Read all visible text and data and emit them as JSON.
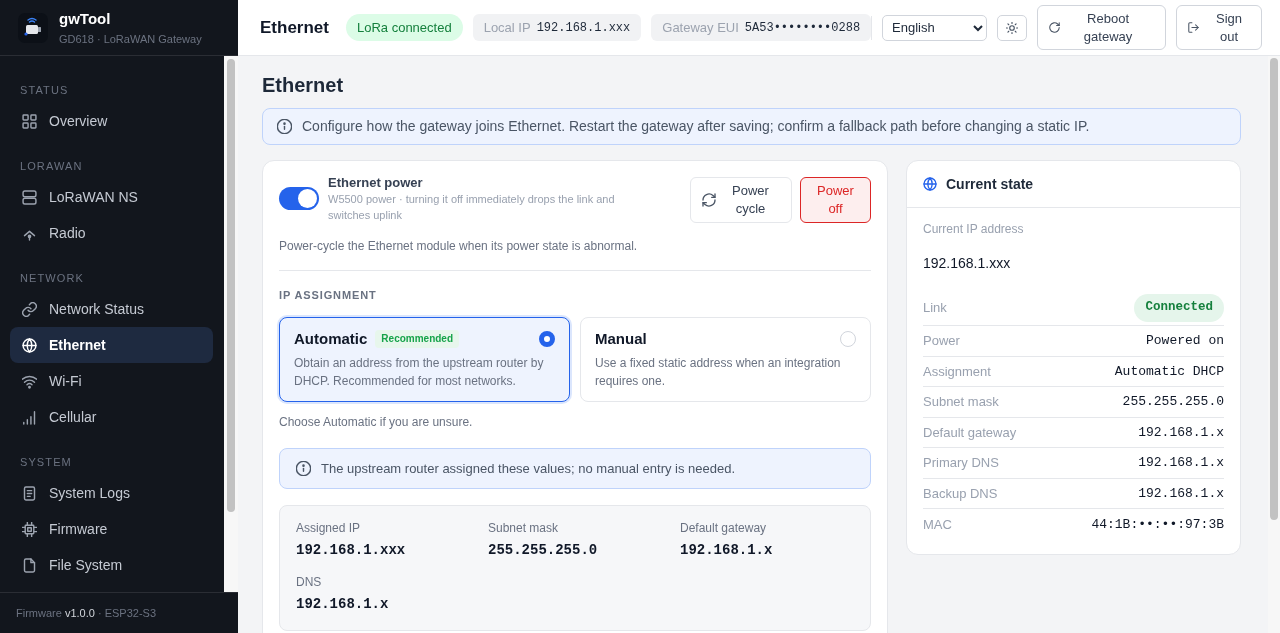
{
  "sidebar": {
    "app_name": "gwTool",
    "subtitle": "GD618 · LoRaWAN Gateway",
    "sections": [
      {
        "title": "STATUS",
        "items": [
          {
            "label": "Overview",
            "selected": false
          }
        ]
      },
      {
        "title": "LORAWAN",
        "items": [
          {
            "label": "LoRaWAN NS",
            "selected": false
          },
          {
            "label": "Radio",
            "selected": false
          }
        ]
      },
      {
        "title": "NETWORK",
        "items": [
          {
            "label": "Network Status",
            "selected": false
          },
          {
            "label": "Ethernet",
            "selected": true
          },
          {
            "label": "Wi-Fi",
            "selected": false
          },
          {
            "label": "Cellular",
            "selected": false
          }
        ]
      },
      {
        "title": "SYSTEM",
        "items": [
          {
            "label": "System Logs",
            "selected": false
          },
          {
            "label": "Firmware",
            "selected": false
          },
          {
            "label": "File System",
            "selected": false
          }
        ]
      }
    ],
    "footer": "Firmware **v1.0.0** · ESP32-S3"
  },
  "top_bar": {
    "title": "Ethernet",
    "status_badge": "LoRa connected",
    "chips": [
      {
        "label": "Local IP",
        "value": "192.168.1.xxx"
      },
      {
        "label": "Gateway EUI",
        "value": "5A53••••••••0288"
      }
    ],
    "language": "English",
    "buttons": [
      "Reboot gateway",
      "Sign out"
    ]
  },
  "page": {
    "title": "Ethernet",
    "notice": "Configure how the gateway joins Ethernet. Restart the gateway after saving; confirm a fallback path before changing a static IP.",
    "ethernet_card": {
      "power": {
        "title": "Ethernet power",
        "on": true,
        "description": "W5500 power · turning it off immediately drops the link and switches uplink",
        "buttons": [
          {
            "label": "Power cycle",
            "kind": "neutral"
          },
          {
            "label": "Power off",
            "kind": "danger"
          }
        ]
      },
      "power_hint": "Power-cycle the Ethernet module when its power state is abnormal.",
      "section_title": "IP ASSIGNMENT",
      "options": [
        {
          "title": "Automatic",
          "badge": "Recommended",
          "description": "Obtain an address from the upstream router by DHCP. Recommended for most networks.",
          "selected": true
        },
        {
          "title": "Manual",
          "description": "Use a fixed static address when an integration requires one.",
          "selected": false
        }
      ],
      "options_hint": "Choose Automatic if you are unsure.",
      "assigned_notice": "The upstream router assigned these values; no manual entry is needed.",
      "assigned_values": [
        {
          "label": "Assigned IP",
          "value": "192.168.1.xxx"
        },
        {
          "label": "Subnet mask",
          "value": "255.255.255.0"
        },
        {
          "label": "Default gateway",
          "value": "192.168.1.x"
        },
        {
          "label": "DNS",
          "value": "192.168.1.x"
        }
      ]
    },
    "current_state": {
      "title": "Current state",
      "ip_label": "Current IP address",
      "ip_value": "192.168.1.xxx",
      "rows": [
        {
          "label": "Link",
          "value": "Connected",
          "kind": "badge"
        },
        {
          "label": "Power",
          "value": "Powered on",
          "kind": "text"
        },
        {
          "label": "Assignment",
          "value": "Automatic DHCP",
          "kind": "text"
        },
        {
          "label": "Subnet mask",
          "value": "255.255.255.0",
          "kind": "text"
        },
        {
          "label": "Default gateway",
          "value": "192.168.1.x",
          "kind": "text"
        },
        {
          "label": "Primary DNS",
          "value": "192.168.1.x",
          "kind": "text"
        },
        {
          "label": "Backup DNS",
          "value": "192.168.1.x",
          "kind": "text"
        },
        {
          "label": "MAC",
          "value": "44:1B:••:••:97:3B",
          "kind": "text"
        }
      ]
    }
  }
}
